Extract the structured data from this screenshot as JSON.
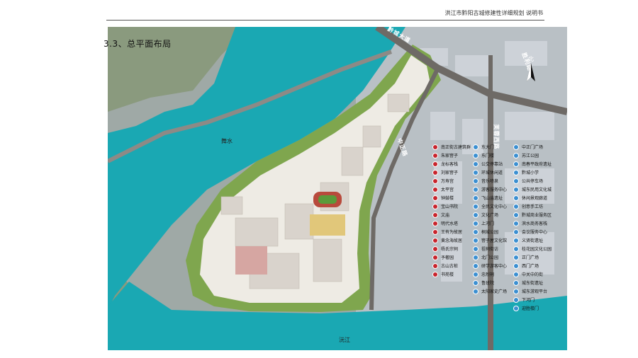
{
  "header": {
    "text": "洪江市黔阳古城修建性详细规划 说明书"
  },
  "section": {
    "title": "3.3、总平面布局"
  },
  "map": {
    "river_labels": {
      "wushui": "舞水",
      "yuanjiang": "沅江"
    },
    "road_labels": [
      "黔城大道",
      "黔城大道",
      "胜利路",
      "芙蓉西路",
      "中正路"
    ],
    "compass_label": "北",
    "colors": {
      "river": "#1aa8b3",
      "old_town_base": "#f0eee8",
      "greenery": "#8db552",
      "legend_red": "#c8242c",
      "legend_blue": "#3b8fd1"
    }
  },
  "legend": {
    "red_items": [
      "南正街古建筑群",
      "朱家窨子",
      "龙标客栈",
      "刘家窨子",
      "万寿宫",
      "太平宫",
      "钟鼓楼",
      "宝山书院",
      "文庙",
      "明代水塔",
      "王有为故居",
      "黄念海故居",
      "杨氏宗祠",
      "予奢园",
      "古山古桩",
      "书苑楼"
    ],
    "blue_items_1": [
      "东大门",
      "东门楼",
      "公交停靠站",
      "环城休闲道",
      "音乐喷泉",
      "游客服务中心",
      "飞山庙遗址",
      "全民文化中心",
      "文化广场",
      "上河门",
      "桐城公园",
      "窨子屋文化馆",
      "祖祠街访",
      "北门公园",
      "研学游客中心",
      "忠烈祠",
      "鲁班院",
      "太阳家史广场"
    ],
    "blue_items_2": [
      "中正门广场",
      "苏江公园",
      "南春平政府遗址",
      "黔城小学",
      "公共停车场",
      "城东民用文化城",
      "休闲景观廊道",
      "创意手工坊",
      "黔城商业服务区",
      "滨水商务客栈",
      "会议服务中心",
      "义贤街遗址",
      "桂花园文化公园",
      "正门广场",
      "西门广场",
      "中关中的街",
      "城东街遗址",
      "城东游观平台",
      "下河门",
      "迎胜楼门"
    ]
  }
}
